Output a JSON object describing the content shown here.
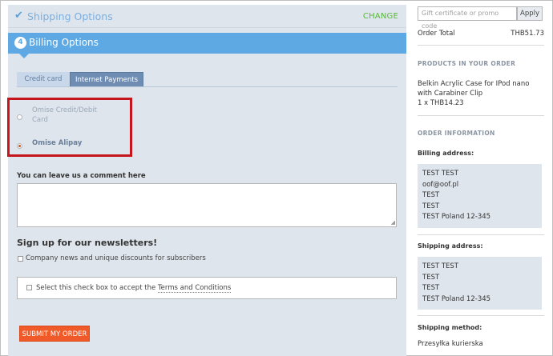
{
  "shipping": {
    "title": "Shipping Options",
    "change_label": "CHANGE"
  },
  "billing": {
    "step": "4",
    "title": "Billing Options"
  },
  "tabs": [
    {
      "label": "Credit card",
      "active": false
    },
    {
      "label": "Internet Payments",
      "active": true
    }
  ],
  "payment_options": [
    {
      "label": "Omise Credit/Debit Card",
      "selected": false
    },
    {
      "label": "Omise Alipay",
      "selected": true
    }
  ],
  "comment": {
    "label": "You can leave us a comment here",
    "value": ""
  },
  "newsletter": {
    "title": "Sign up for our newsletters!",
    "option_label": "Company news and unique discounts for subscribers",
    "checked": false
  },
  "terms": {
    "prefix": "Select this check box to accept the ",
    "link_label": "Terms and Conditions",
    "checked": false
  },
  "submit_label": "SUBMIT MY ORDER",
  "sidebar": {
    "promo_placeholder": "Gift certificate or promo code",
    "apply_label": "Apply",
    "order_total_label": "Order Total",
    "order_total_value": "THB51.73",
    "products_heading": "PRODUCTS IN YOUR ORDER",
    "product_name": "Belkin Acrylic Case for IPod nano with Carabiner Clip",
    "product_qty": "1 x THB14.23",
    "order_info_heading": "ORDER INFORMATION",
    "billing_address_label": "Billing address:",
    "billing_address": [
      "TEST TEST",
      "oof@oof.pl",
      "TEST",
      "TEST",
      "TEST Poland 12-345"
    ],
    "shipping_address_label": "Shipping address:",
    "shipping_address": [
      "TEST TEST",
      "TEST",
      "TEST",
      "TEST Poland 12-345"
    ],
    "shipping_method_label": "Shipping method:",
    "shipping_method": "Przesyłka kurierska"
  },
  "colors": {
    "accent_blue": "#5ea9e3",
    "change_green": "#57b83a",
    "submit_orange": "#f05a28",
    "highlight_red": "#c4161c",
    "panel_bg": "#dfe5ec"
  }
}
